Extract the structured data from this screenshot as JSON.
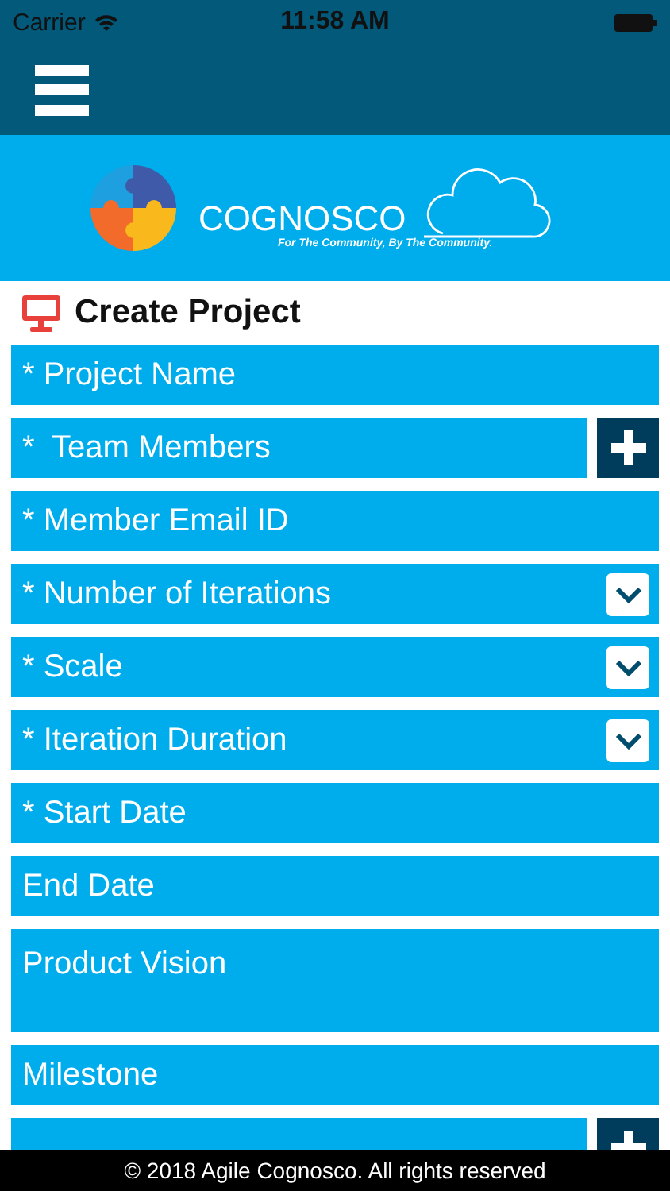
{
  "status_bar": {
    "carrier": "Carrier",
    "time": "11:58 AM"
  },
  "banner": {
    "brand": "COGNOSCO",
    "tagline": "For The Community, By The Community."
  },
  "title": "Create Project",
  "fields": [
    {
      "kind": "text",
      "placeholder": "* Project Name"
    },
    {
      "kind": "add",
      "placeholder": "*  Team Members"
    },
    {
      "kind": "text",
      "placeholder": "* Member Email ID"
    },
    {
      "kind": "select",
      "placeholder": "* Number of Iterations"
    },
    {
      "kind": "select",
      "placeholder": "* Scale"
    },
    {
      "kind": "select",
      "placeholder": "* Iteration Duration"
    },
    {
      "kind": "text",
      "placeholder": "* Start Date"
    },
    {
      "kind": "text",
      "placeholder": "End Date"
    },
    {
      "kind": "textarea",
      "placeholder": "Product Vision"
    },
    {
      "kind": "text",
      "placeholder": "Milestone"
    },
    {
      "kind": "add"
    }
  ],
  "footer": "© 2018 Agile Cognosco. All rights reserved"
}
